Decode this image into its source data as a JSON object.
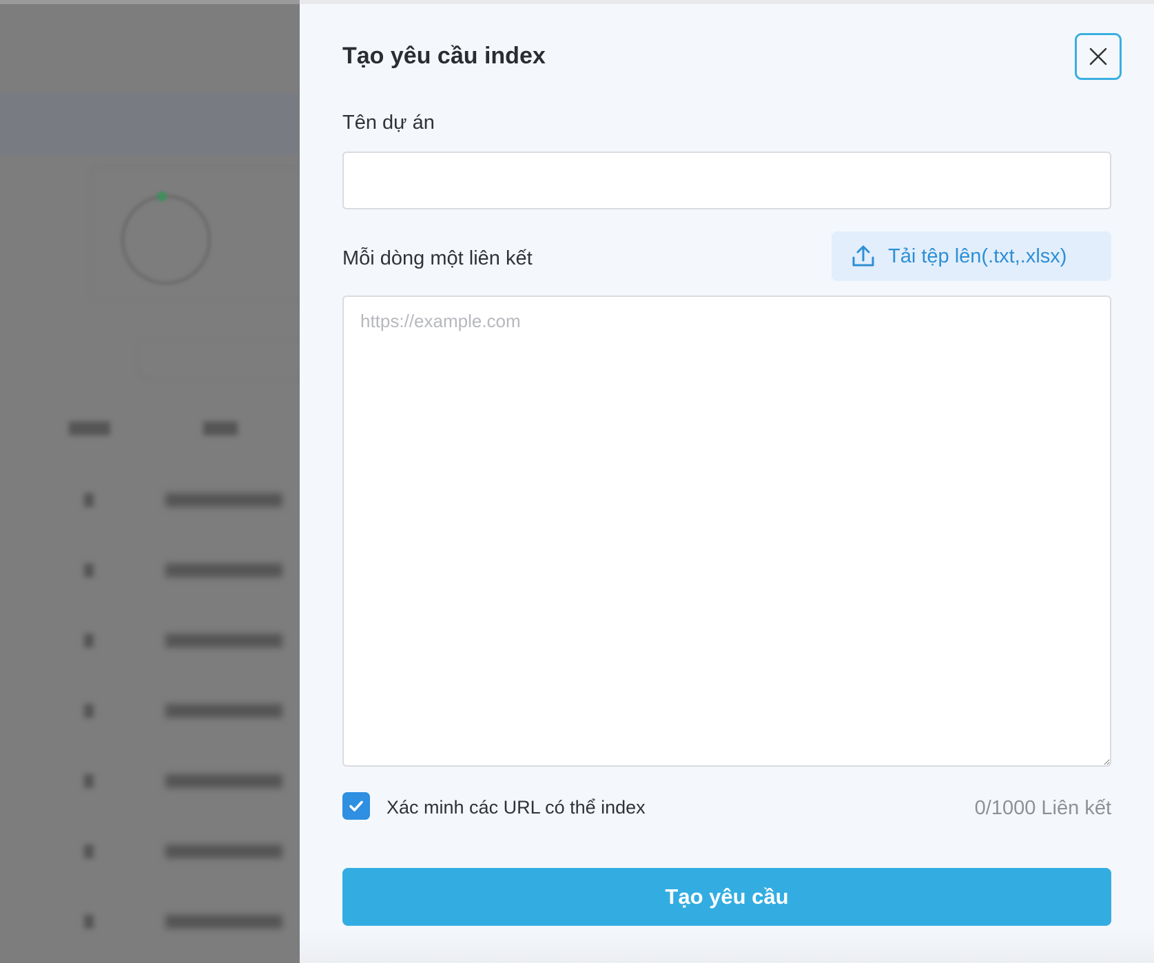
{
  "dialog": {
    "title": "Tạo yêu cầu index",
    "close_icon": "close-icon",
    "project_name": {
      "label": "Tên dự án",
      "value": "",
      "placeholder": ""
    },
    "links": {
      "label": "Mỗi dòng một liên kết",
      "value": "",
      "placeholder": "https://example.com"
    },
    "upload": {
      "icon": "upload-icon",
      "label": "Tải tệp lên(.txt,.xlsx)"
    },
    "verify": {
      "checked": true,
      "label": "Xác minh các URL có thể index"
    },
    "counter": "0/1000 Liên kết",
    "submit_label": "Tạo yêu cầu"
  },
  "colors": {
    "accent": "#33ade1",
    "link_blue": "#2d8fd6",
    "checkbox": "#2f8fe0",
    "dialog_bg": "#f4f8fc",
    "overlay": "#7d7d7d"
  }
}
